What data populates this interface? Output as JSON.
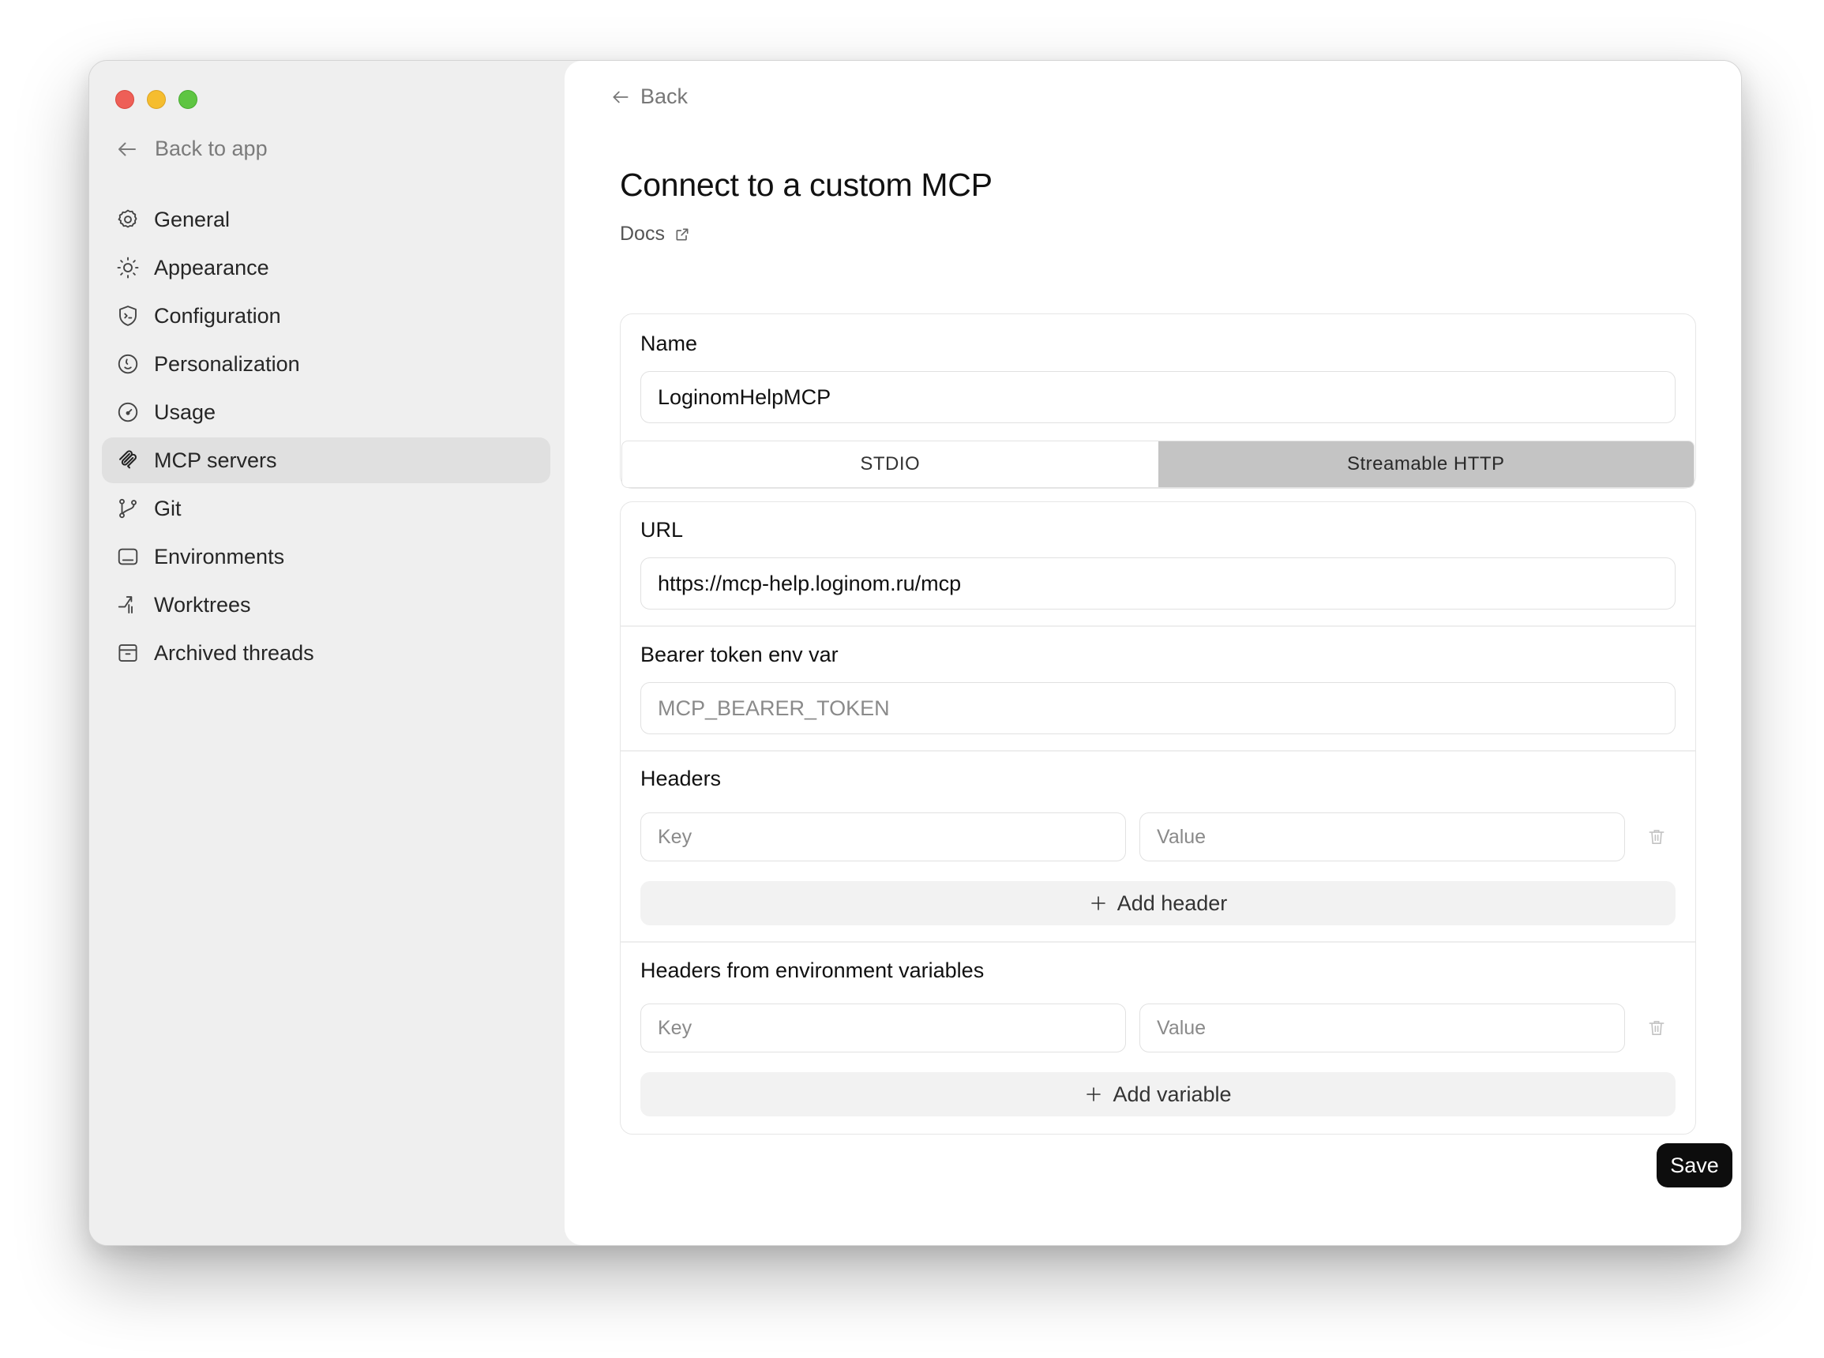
{
  "sidebar": {
    "back_label": "Back to app",
    "items": [
      {
        "label": "General",
        "icon": "gear-icon"
      },
      {
        "label": "Appearance",
        "icon": "sun-icon"
      },
      {
        "label": "Configuration",
        "icon": "shield-terminal-icon"
      },
      {
        "label": "Personalization",
        "icon": "face-icon"
      },
      {
        "label": "Usage",
        "icon": "gauge-icon"
      },
      {
        "label": "MCP servers",
        "icon": "mcp-icon",
        "active": true
      },
      {
        "label": "Git",
        "icon": "git-branch-icon"
      },
      {
        "label": "Environments",
        "icon": "window-icon"
      },
      {
        "label": "Worktrees",
        "icon": "worktree-icon"
      },
      {
        "label": "Archived threads",
        "icon": "archive-icon"
      }
    ]
  },
  "main": {
    "back_label": "Back",
    "title": "Connect to a custom MCP",
    "docs_label": "Docs",
    "name": {
      "label": "Name",
      "value": "LoginomHelpMCP"
    },
    "transport": {
      "options": [
        "STDIO",
        "Streamable HTTP"
      ],
      "selected": "Streamable HTTP"
    },
    "url": {
      "label": "URL",
      "value": "https://mcp-help.loginom.ru/mcp"
    },
    "bearer": {
      "label": "Bearer token env var",
      "placeholder": "MCP_BEARER_TOKEN"
    },
    "headers": {
      "label": "Headers",
      "key_placeholder": "Key",
      "value_placeholder": "Value",
      "add_label": "Add header"
    },
    "env_headers": {
      "label": "Headers from environment variables",
      "key_placeholder": "Key",
      "value_placeholder": "Value",
      "add_label": "Add variable"
    },
    "save_label": "Save"
  },
  "colors": {
    "sidebar_bg": "#efefef",
    "active_item_bg": "#e0e0e0",
    "selected_segment_bg": "#c4c4c4",
    "save_button_bg": "#0d0d0d",
    "traffic_red": "#ee5f57",
    "traffic_yellow": "#f5bd2f",
    "traffic_green": "#5ec542"
  }
}
